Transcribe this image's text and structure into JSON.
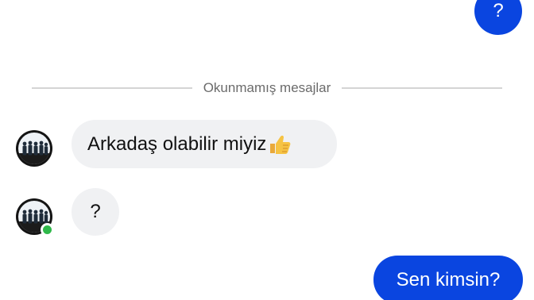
{
  "chat": {
    "messages": [
      {
        "direction": "outgoing",
        "text": "?"
      },
      {
        "direction": "incoming",
        "text": "Arkadaş olabilir miyiz",
        "emoji": "thumbs-up-icon"
      },
      {
        "direction": "incoming",
        "text": "?"
      },
      {
        "direction": "outgoing",
        "text": "Sen kimsin?"
      }
    ],
    "unread_divider_label": "Okunmamış mesajlar",
    "contact": {
      "avatar": "group-photo-avatar",
      "online": true
    },
    "colors": {
      "outgoing_bubble": "#0a45e0",
      "incoming_bubble": "#f0f1f3",
      "online_dot": "#2fb84a"
    }
  }
}
